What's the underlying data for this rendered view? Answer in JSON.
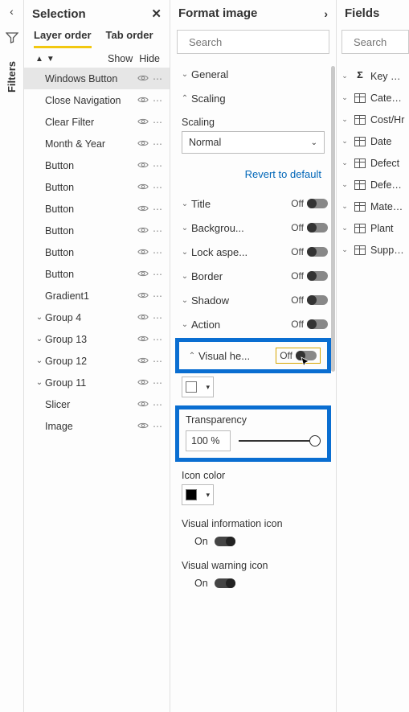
{
  "rail": {
    "collapse_selection": "‹",
    "filters_label": "Filters"
  },
  "selection": {
    "title": "Selection",
    "tabs": {
      "layer": "Layer order",
      "taborder": "Tab order"
    },
    "subtoolbar": {
      "show": "Show",
      "hide": "Hide"
    },
    "layers": [
      {
        "name": "Windows Button",
        "selected": true
      },
      {
        "name": "Close Navigation"
      },
      {
        "name": "Clear Filter"
      },
      {
        "name": "Month & Year"
      },
      {
        "name": "Button"
      },
      {
        "name": "Button"
      },
      {
        "name": "Button"
      },
      {
        "name": "Button"
      },
      {
        "name": "Button"
      },
      {
        "name": "Button"
      },
      {
        "name": "Gradient1"
      },
      {
        "name": "Group 4",
        "group": true
      },
      {
        "name": "Group 13",
        "group": true
      },
      {
        "name": "Group 12",
        "group": true
      },
      {
        "name": "Group 11",
        "group": true
      },
      {
        "name": "Slicer"
      },
      {
        "name": "Image"
      }
    ]
  },
  "format": {
    "title": "Format image",
    "search_placeholder": "Search",
    "sections": {
      "general": "General",
      "scaling": "Scaling",
      "scaling_label": "Scaling",
      "scaling_value": "Normal",
      "revert": "Revert to default",
      "title": "Title",
      "background": "Backgrou...",
      "lock_aspect": "Lock aspe...",
      "border": "Border",
      "shadow": "Shadow",
      "action": "Action",
      "visual_header": "Visual he...",
      "transparency": "Transparency",
      "transparency_value": "100 %",
      "icon_color": "Icon color",
      "visual_info_icon": "Visual information icon",
      "visual_warning_icon": "Visual warning icon",
      "off": "Off",
      "on": "On"
    }
  },
  "fields": {
    "title": "Fields",
    "search_placeholder": "Search",
    "items": [
      {
        "name": "Key Mea",
        "sigma": true
      },
      {
        "name": "Category"
      },
      {
        "name": "Cost/Hr"
      },
      {
        "name": "Date"
      },
      {
        "name": "Defect"
      },
      {
        "name": "DefectTy"
      },
      {
        "name": "Material"
      },
      {
        "name": "Plant"
      },
      {
        "name": "Supplier"
      }
    ]
  }
}
